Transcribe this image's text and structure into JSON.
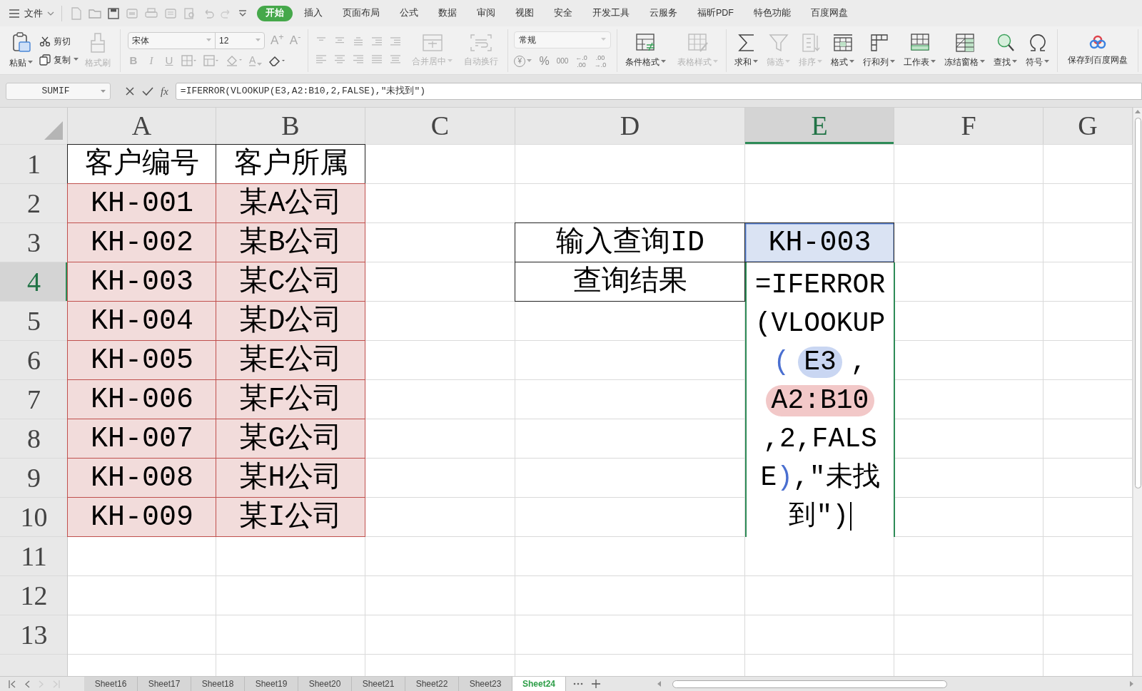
{
  "menu_bar": {
    "file_menu": "文件",
    "tabs": [
      {
        "label": "开始",
        "selected": true
      },
      {
        "label": "插入",
        "selected": false
      },
      {
        "label": "页面布局",
        "selected": false
      },
      {
        "label": "公式",
        "selected": false
      },
      {
        "label": "数据",
        "selected": false
      },
      {
        "label": "审阅",
        "selected": false
      },
      {
        "label": "视图",
        "selected": false
      },
      {
        "label": "安全",
        "selected": false
      },
      {
        "label": "开发工具",
        "selected": false
      },
      {
        "label": "云服务",
        "selected": false
      },
      {
        "label": "福昕PDF",
        "selected": false
      },
      {
        "label": "特色功能",
        "selected": false
      },
      {
        "label": "百度网盘",
        "selected": false
      }
    ]
  },
  "ribbon": {
    "paste": {
      "label": "粘贴",
      "dropdown": true,
      "disabled": false
    },
    "clipboard_small": [
      {
        "label": "剪切",
        "dropdown": false,
        "disabled": false
      },
      {
        "label": "复制",
        "dropdown": true,
        "disabled": false
      }
    ],
    "format_painter": {
      "label": "格式刷",
      "dropdown": false,
      "disabled": true
    },
    "font": {
      "name": "宋体",
      "size": "12"
    },
    "size_buttons": [
      {
        "glyph": "A$^{+}$"
      },
      {
        "glyph": "A$^{-}$"
      }
    ],
    "style_glyphs": [
      {
        "glyph": "B",
        "kind": "bold"
      },
      {
        "glyph": "I",
        "kind": "italic"
      },
      {
        "glyph": "U",
        "kind": "underline"
      }
    ],
    "font_color": {
      "glyph": "A"
    },
    "align_buttons": [
      {
        "label": "合并居中",
        "dropdown": true,
        "disabled": true
      },
      {
        "label": "自动换行",
        "dropdown": false,
        "disabled": true
      }
    ],
    "number_format": {
      "value": "常规"
    },
    "number_buttons": [
      {
        "lines": [
          "¥"
        ],
        "kind": "circle",
        "dropdown": true
      },
      {
        "lines": [
          "%"
        ],
        "kind": "plain",
        "dropdown": false
      },
      {
        "lines": [
          "000"
        ],
        "kind": "plain",
        "dropdown": false
      },
      {
        "lines": [
          "←.0",
          ".00"
        ],
        "kind": "stack",
        "dropdown": false
      },
      {
        "lines": [
          ".00",
          "→.0"
        ],
        "kind": "stack",
        "dropdown": false
      }
    ],
    "style_buttons": [
      {
        "label": "条件格式",
        "dropdown": true,
        "disabled": false
      },
      {
        "label": "表格样式",
        "dropdown": true,
        "disabled": true
      }
    ],
    "tool_buttons": [
      {
        "label": "求和",
        "dropdown": true,
        "disabled": false
      },
      {
        "label": "筛选",
        "dropdown": true,
        "disabled": true
      },
      {
        "label": "排序",
        "dropdown": true,
        "disabled": true
      },
      {
        "label": "格式",
        "dropdown": true,
        "disabled": false
      },
      {
        "label": "行和列",
        "dropdown": true,
        "disabled": false
      },
      {
        "label": "工作表",
        "dropdown": true,
        "disabled": false
      },
      {
        "label": "冻结窗格",
        "dropdown": true,
        "disabled": false
      },
      {
        "label": "查找",
        "dropdown": true,
        "disabled": false
      },
      {
        "label": "符号",
        "dropdown": true,
        "disabled": false
      }
    ],
    "cloud_button": {
      "label": "保存到百度网盘"
    }
  },
  "formula_bar": {
    "name_box": "SUMIF",
    "fx": "fx",
    "formula": "=IFERROR(VLOOKUP(E3,A2:B10,2,FALSE),″未找到″)"
  },
  "sheet": {
    "columns": [
      {
        "label": "A",
        "selected": false
      },
      {
        "label": "B",
        "selected": false
      },
      {
        "label": "C",
        "selected": false
      },
      {
        "label": "D",
        "selected": false
      },
      {
        "label": "E",
        "selected": true
      },
      {
        "label": "F",
        "selected": false
      },
      {
        "label": "G",
        "selected": false
      }
    ],
    "rows": [
      {
        "label": "1",
        "selected": false
      },
      {
        "label": "2",
        "selected": false
      },
      {
        "label": "3",
        "selected": false
      },
      {
        "label": "4",
        "selected": true
      },
      {
        "label": "5",
        "selected": false
      },
      {
        "label": "6",
        "selected": false
      },
      {
        "label": "7",
        "selected": false
      },
      {
        "label": "8",
        "selected": false
      },
      {
        "label": "9",
        "selected": false
      },
      {
        "label": "10",
        "selected": false
      },
      {
        "label": "11",
        "selected": false
      },
      {
        "label": "12",
        "selected": false
      },
      {
        "label": "13",
        "selected": false
      }
    ],
    "data_table": {
      "header": [
        "客户编号",
        "客户所属"
      ],
      "rows": [
        [
          "KH-001",
          "某A公司"
        ],
        [
          "KH-002",
          "某B公司"
        ],
        [
          "KH-003",
          "某C公司"
        ],
        [
          "KH-004",
          "某D公司"
        ],
        [
          "KH-005",
          "某E公司"
        ],
        [
          "KH-006",
          "某F公司"
        ],
        [
          "KH-007",
          "某G公司"
        ],
        [
          "KH-008",
          "某H公司"
        ],
        [
          "KH-009",
          "某I公司"
        ]
      ]
    },
    "lookup": {
      "label": "输入查询ID",
      "value": "KH-003",
      "result_label": "查询结果"
    },
    "cell_editor": {
      "parts": [
        {
          "text": "=IFERROR(VLOOKUP",
          "kind": "plain"
        },
        {
          "text": "(",
          "kind": "paren",
          "color": "#4a6fd0"
        },
        {
          "text": "E3",
          "kind": "ref",
          "color": "#c9d6f2"
        },
        {
          "text": ",",
          "kind": "plain"
        },
        {
          "text": "A2:B10",
          "kind": "ref",
          "color": "#f2c8c8"
        },
        {
          "text": ",2,FALSE",
          "kind": "plain"
        },
        {
          "text": ")",
          "kind": "paren",
          "color": "#4a6fd0"
        },
        {
          "text": ",″未找到″)",
          "kind": "plain"
        }
      ]
    }
  },
  "sheet_tabs": [
    {
      "label": "Sheet16",
      "selected": false
    },
    {
      "label": "Sheet17",
      "selected": false
    },
    {
      "label": "Sheet18",
      "selected": false
    },
    {
      "label": "Sheet19",
      "selected": false
    },
    {
      "label": "Sheet20",
      "selected": false
    },
    {
      "label": "Sheet21",
      "selected": false
    },
    {
      "label": "Sheet22",
      "selected": false
    },
    {
      "label": "Sheet23",
      "selected": false
    },
    {
      "label": "Sheet24",
      "selected": true
    }
  ]
}
